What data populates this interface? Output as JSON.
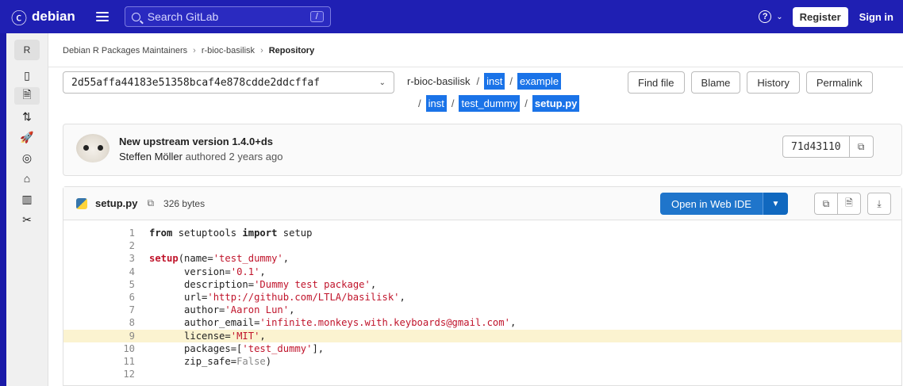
{
  "navbar": {
    "brand": "debian",
    "search_placeholder": "Search GitLab",
    "search_shortcut": "/",
    "help_icon": "?",
    "register_label": "Register",
    "signin_label": "Sign in"
  },
  "sidebar": {
    "project_initial": "R",
    "items": [
      {
        "icon": "project-overview-icon",
        "glyph": "▯"
      },
      {
        "icon": "repository-icon",
        "glyph": "🗎"
      },
      {
        "icon": "merge-requests-icon",
        "glyph": "⇅"
      },
      {
        "icon": "deployments-icon",
        "glyph": "🚀"
      },
      {
        "icon": "monitor-icon",
        "glyph": "◎"
      },
      {
        "icon": "packages-icon",
        "glyph": "⌂"
      },
      {
        "icon": "analytics-icon",
        "glyph": "▥"
      },
      {
        "icon": "snippets-icon",
        "glyph": "✂"
      }
    ]
  },
  "breadcrumb": {
    "group": "Debian R Packages Maintainers",
    "project": "r-bioc-basilisk",
    "current": "Repository"
  },
  "ref": {
    "value": "2d55affa44183e51358bcaf4e878cdde2ddcffaf"
  },
  "path": {
    "root": "r-bioc-basilisk",
    "seg1": "inst",
    "seg2": "example",
    "seg3": "inst",
    "seg4": "test_dummy",
    "file": "setup.py"
  },
  "file_actions": {
    "find_file": "Find file",
    "blame": "Blame",
    "history": "History",
    "permalink": "Permalink"
  },
  "commit": {
    "title": "New upstream version 1.4.0+ds",
    "author": "Steffen Möller",
    "meta": "authored 2 years ago",
    "sha": "71d43110"
  },
  "file": {
    "name": "setup.py",
    "size": "326 bytes",
    "open_ide": "Open in Web IDE",
    "highlighted_line": 9
  },
  "code_lines": [
    {
      "n": "1"
    },
    {
      "n": "2"
    },
    {
      "n": "3"
    },
    {
      "n": "4"
    },
    {
      "n": "5"
    },
    {
      "n": "6"
    },
    {
      "n": "7"
    },
    {
      "n": "8"
    },
    {
      "n": "9"
    },
    {
      "n": "10"
    },
    {
      "n": "11"
    },
    {
      "n": "12"
    }
  ],
  "code": {
    "l1_a": "from",
    "l1_b": " setuptools ",
    "l1_c": "import",
    "l1_d": " setup",
    "l3_fn": "setup",
    "l3_rest": "(name=",
    "l3_str": "'test_dummy'",
    "l3_end": ",",
    "l4_k": "      version=",
    "l4_v": "'0.1'",
    "l5_k": "      description=",
    "l5_v": "'Dummy test package'",
    "l6_k": "      url=",
    "l6_v": "'http://github.com/LTLA/basilisk'",
    "l7_k": "      author=",
    "l7_v": "'Aaron Lun'",
    "l8_k": "      author_email=",
    "l8_v": "'infinite.monkeys.with.keyboards@gmail.com'",
    "l9_k": "      license=",
    "l9_v": "'MIT'",
    "l10_k": "      packages=[",
    "l10_v": "'test_dummy'",
    "l10_end": "],",
    "l11_k": "      zip_safe=",
    "l11_v": "False",
    "l11_end": ")",
    "comma": ","
  }
}
